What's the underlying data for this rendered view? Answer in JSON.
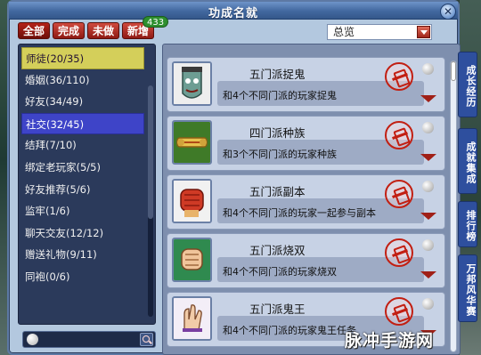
{
  "window": {
    "title": "功成名就"
  },
  "tabs": [
    {
      "label": "全部"
    },
    {
      "label": "完成"
    },
    {
      "label": "未做"
    },
    {
      "label": "新增"
    }
  ],
  "new_count": "433",
  "filter": {
    "selected": "总览"
  },
  "categories": [
    {
      "label": "师徒(20/35)"
    },
    {
      "label": "婚姻(36/110)"
    },
    {
      "label": "好友(34/49)"
    },
    {
      "label": "社交(32/45)"
    },
    {
      "label": "结拜(7/10)"
    },
    {
      "label": "绑定老玩家(5/5)"
    },
    {
      "label": "好友推荐(5/6)"
    },
    {
      "label": "监牢(1/6)"
    },
    {
      "label": "聊天交友(12/12)"
    },
    {
      "label": "赠送礼物(9/11)"
    },
    {
      "label": "同袍(0/6)"
    }
  ],
  "search": {
    "value": ""
  },
  "achievements": [
    {
      "name": "五门派捉鬼",
      "desc": "和4个不同门派的玩家捉鬼",
      "icon": "ghost-face-icon"
    },
    {
      "name": "四门派种族",
      "desc": "和3个不同门派的玩家种族",
      "icon": "green-scroll-icon"
    },
    {
      "name": "五门派副本",
      "desc": "和4个不同门派的玩家一起参与副本",
      "icon": "red-fist-icon"
    },
    {
      "name": "五门派烧双",
      "desc": "和4个不同门派的玩家烧双",
      "icon": "fist-green-icon"
    },
    {
      "name": "五门派鬼王",
      "desc": "和4个不同门派的玩家鬼王任务",
      "icon": "hand-icon"
    }
  ],
  "side_tabs": [
    {
      "label": "成长经历"
    },
    {
      "label": "成就集成"
    },
    {
      "label": "排行榜"
    },
    {
      "label": "万邦风华赛"
    }
  ],
  "watermark": "脉冲手游网",
  "colors": {
    "seal": "#c21f12",
    "tab": "#b4231a",
    "selected_yellow": "#d4cf5a",
    "selected_blue": "#3e44c8"
  }
}
